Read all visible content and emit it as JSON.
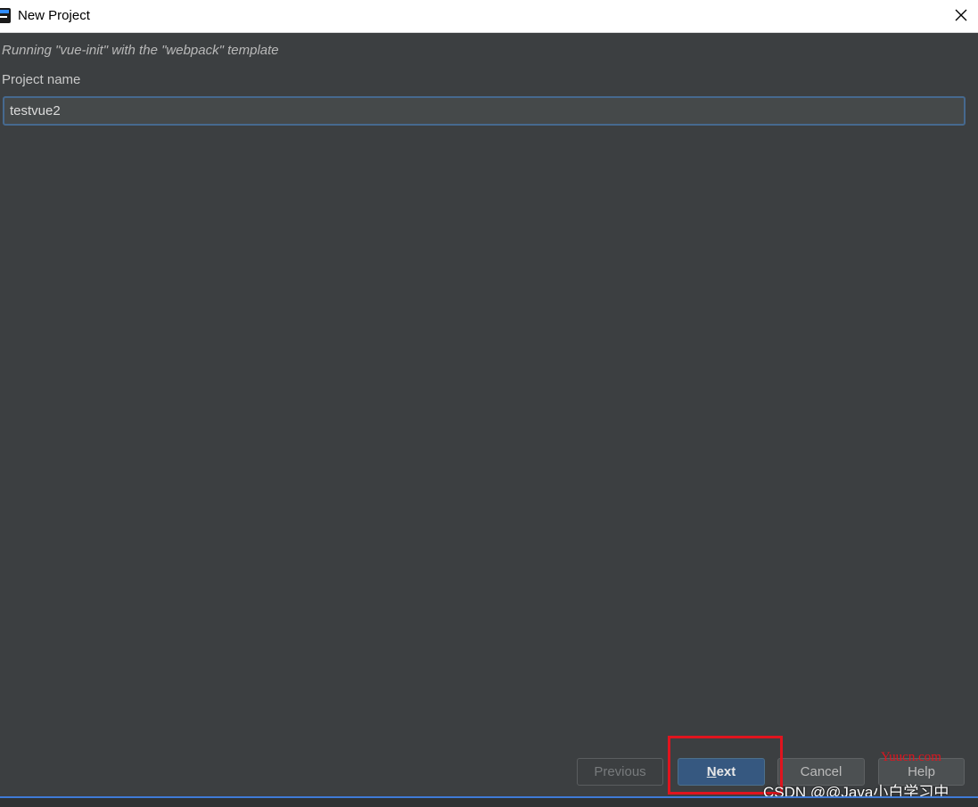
{
  "window": {
    "title": "New Project",
    "icon": "intellij-app-icon",
    "close_icon": "close-icon"
  },
  "wizard": {
    "subtitle": "Running \"vue-init\" with the \"webpack\" template",
    "project_name_label": "Project name",
    "project_name_value": "testvue2"
  },
  "buttons": {
    "previous": "Previous",
    "next_mnemonic": "N",
    "next_rest": "ext",
    "cancel": "Cancel",
    "help": "Help"
  },
  "watermarks": {
    "site": "Yuucn.com",
    "csdn": "CSDN @@Java小白学习中"
  },
  "colors": {
    "background": "#3c3f41",
    "accent": "#365880",
    "input_focus": "#46698f",
    "highlight": "#e0141e"
  }
}
